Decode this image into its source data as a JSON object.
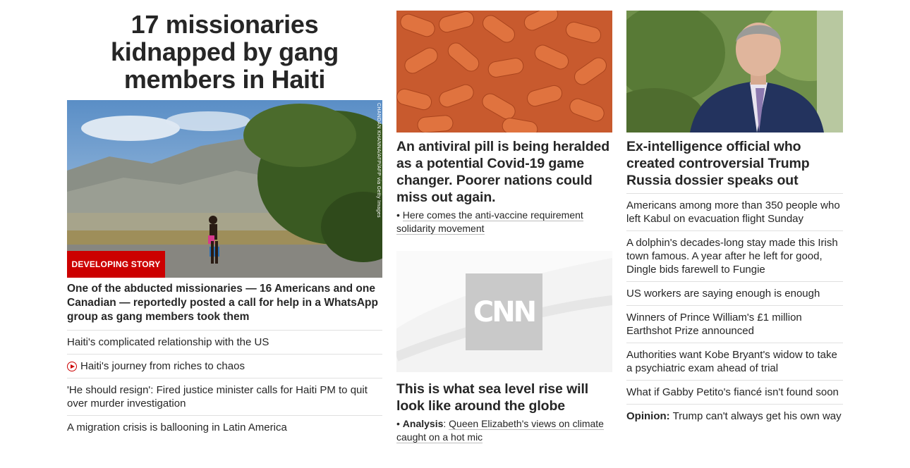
{
  "col1": {
    "headline": "17 missionaries kidnapped by gang members in Haiti",
    "photo_credit": "CHANDAN KHANNA/AFP/AFP via Getty Images",
    "badge": "DEVELOPING STORY",
    "lead": "One of the abducted missionaries — 16 Americans and one Canadian — reportedly posted a call for help in a WhatsApp group as gang members took them",
    "links": [
      "Haiti's complicated relationship with the US",
      "Haiti's journey from riches to chaos",
      "'He should resign': Fired justice minister calls for Haiti PM to quit over murder investigation",
      "A migration crisis is ballooning in Latin America"
    ]
  },
  "col2": {
    "card1_title": "An antiviral pill is being heralded as a potential Covid-19 game changer. Poorer nations could miss out again.",
    "card1_sub": "Here comes the anti-vaccine requirement solidarity movement",
    "card2_logo": "CNN",
    "card2_title": "This is what sea level rise will look like around the globe",
    "card2_sub_label": "Analysis",
    "card2_sub": "Queen Elizabeth's views on climate caught on a hot mic"
  },
  "col3": {
    "title": "Ex-intelligence official who created controversial Trump Russia dossier speaks out",
    "links": [
      "Americans among more than 350 people who left Kabul on evacuation flight Sunday",
      "A dolphin's decades-long stay made this Irish town famous. A year after he left for good, Dingle bids farewell to Fungie",
      "US workers are saying enough is enough",
      "Winners of Prince William's £1 million Earthshot Prize announced",
      "Authorities want Kobe Bryant's widow to take a psychiatric exam ahead of trial",
      "What if Gabby Petito's fiancé isn't found soon"
    ],
    "opinion_label": "Opinion:",
    "opinion_text": "Trump can't always get his own way"
  },
  "colors": {
    "accent": "#cc0000",
    "text": "#262626",
    "divider": "#e0e0e0"
  }
}
